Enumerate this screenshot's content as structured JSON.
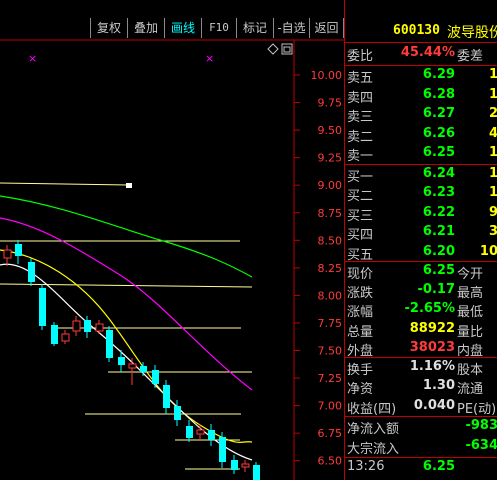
{
  "toolbar": {
    "buttons": [
      {
        "label": "复权"
      },
      {
        "label": "叠加"
      },
      {
        "label": "画线"
      },
      {
        "label": "F10"
      },
      {
        "label": "标记"
      },
      {
        "label": "-自选"
      },
      {
        "label": "返回"
      }
    ],
    "icons": [
      "diamond-icon",
      "restore-window-icon"
    ]
  },
  "chart": {
    "y_labels": [
      "10.00",
      "9.75",
      "9.50",
      "9.25",
      "9.00",
      "8.75",
      "8.50",
      "8.25",
      "8.00",
      "7.75",
      "7.50",
      "7.25",
      "7.00",
      "6.75",
      "6.50"
    ],
    "markers": [
      "×",
      "×"
    ],
    "colors": {
      "axis": "#ff3b3b",
      "grid": "#c00000",
      "up": "#ff3b3b",
      "down": "#00ffff",
      "ma5": "#ffffff",
      "ma10": "#ffff00",
      "ma20": "#ff00ff",
      "ma60": "#00ff00"
    }
  },
  "stock": {
    "code": "600130",
    "name": "波导股份"
  },
  "quote": {
    "weibi": {
      "label": "委比",
      "value": "45.44%",
      "label2": "委差",
      "value2": "1"
    },
    "sells": [
      {
        "label": "卖五",
        "price": "6.29",
        "vol": "1"
      },
      {
        "label": "卖四",
        "price": "6.28",
        "vol": "1"
      },
      {
        "label": "卖三",
        "price": "6.27",
        "vol": "2"
      },
      {
        "label": "卖二",
        "price": "6.26",
        "vol": "4"
      },
      {
        "label": "卖一",
        "price": "6.25",
        "vol": "1"
      }
    ],
    "buys": [
      {
        "label": "买一",
        "price": "6.24",
        "vol": "1"
      },
      {
        "label": "买二",
        "price": "6.23",
        "vol": "1"
      },
      {
        "label": "买三",
        "price": "6.22",
        "vol": "9"
      },
      {
        "label": "买四",
        "price": "6.21",
        "vol": "3"
      },
      {
        "label": "买五",
        "price": "6.20",
        "vol": "10"
      }
    ],
    "stats": [
      {
        "label": "现价",
        "value": "6.25",
        "label2": "今开",
        "value2": ""
      },
      {
        "label": "涨跌",
        "value": "-0.17",
        "label2": "最高",
        "value2": ""
      },
      {
        "label": "涨幅",
        "value": "-2.65%",
        "label2": "最低",
        "value2": ""
      },
      {
        "label": "总量",
        "value": "88922",
        "label2": "量比",
        "value2": ""
      },
      {
        "label": "外盘",
        "value": "38023",
        "label2": "内盘",
        "value2": ""
      }
    ],
    "stats2": [
      {
        "label": "换手",
        "value": "1.16%",
        "label2": "股本",
        "value2": ""
      },
      {
        "label": "净资",
        "value": "1.30",
        "label2": "流通",
        "value2": ""
      },
      {
        "label": "收益(四)",
        "value": "0.040",
        "label2": "PE(动)",
        "value2": ""
      }
    ],
    "flows": [
      {
        "label": "净流入额",
        "value": "-983"
      },
      {
        "label": "大宗流入",
        "value": "-634"
      }
    ],
    "tick": {
      "time": "13:26",
      "price": "6.25"
    }
  }
}
